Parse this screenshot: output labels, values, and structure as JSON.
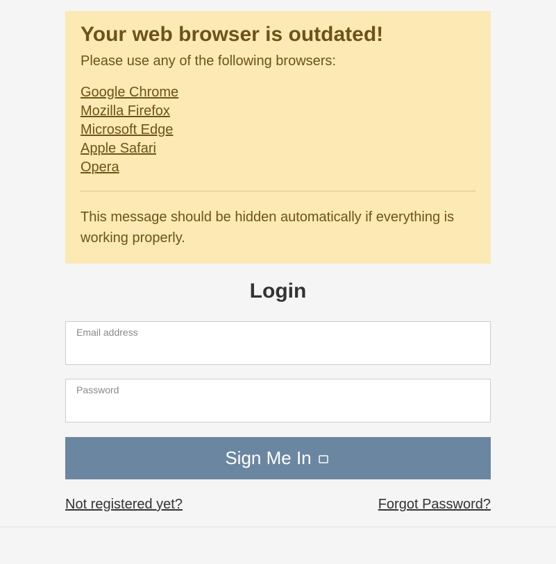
{
  "alert": {
    "title": "Your web browser is outdated!",
    "subtitle": "Please use any of the following browsers:",
    "browsers": [
      "Google Chrome",
      "Mozilla Firefox",
      "Microsoft Edge",
      "Apple Safari",
      "Opera"
    ],
    "footer": "This message should be hidden automatically if everything is working properly."
  },
  "login": {
    "title": "Login",
    "email_label": "Email address",
    "password_label": "Password",
    "submit_label": "Sign Me In",
    "register_link": "Not registered yet?",
    "forgot_link": "Forgot Password?"
  }
}
